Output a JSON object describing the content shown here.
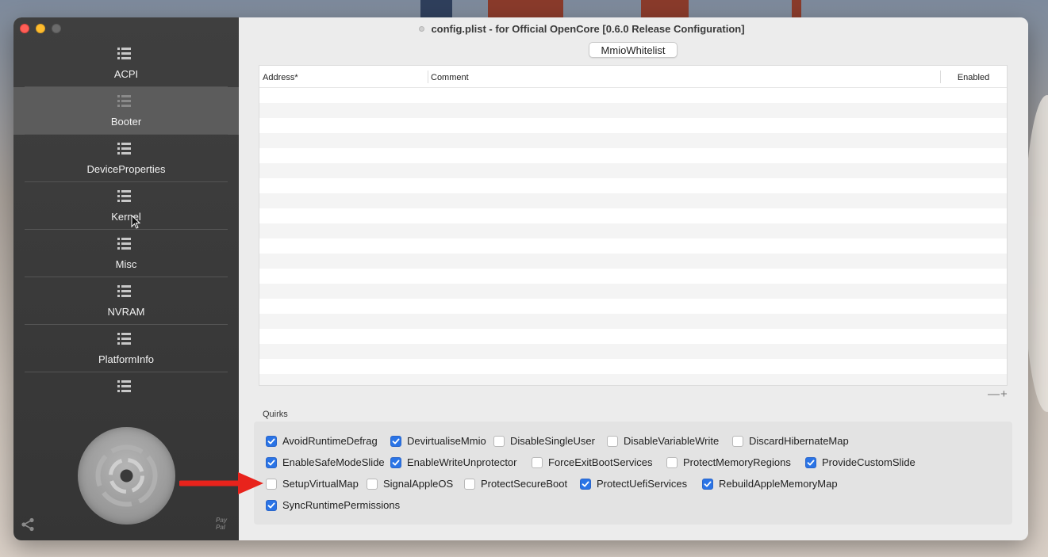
{
  "window": {
    "title": "config.plist - for Official OpenCore [0.6.0 Release Configuration]"
  },
  "sidebar": {
    "items": [
      {
        "label": "ACPI",
        "icon": "list-icon",
        "active": false
      },
      {
        "label": "Booter",
        "icon": "list-icon",
        "active": true
      },
      {
        "label": "DeviceProperties",
        "icon": "list-icon",
        "active": false
      },
      {
        "label": "Kernel",
        "icon": "list-icon",
        "active": false
      },
      {
        "label": "Misc",
        "icon": "list-icon",
        "active": false
      },
      {
        "label": "NVRAM",
        "icon": "list-icon",
        "active": false
      },
      {
        "label": "PlatformInfo",
        "icon": "list-icon",
        "active": false
      },
      {
        "label": "",
        "icon": "list-icon",
        "active": false
      }
    ],
    "paypal": "Pay\nPal"
  },
  "main": {
    "tab_label": "MmioWhitelist",
    "table": {
      "columns": [
        "Address*",
        "Comment",
        "Enabled"
      ],
      "rows": []
    },
    "add_remove": "—+",
    "quirks_label": "Quirks",
    "quirks": [
      {
        "label": "AvoidRuntimeDefrag",
        "checked": true
      },
      {
        "label": "DevirtualiseMmio",
        "checked": true
      },
      {
        "label": "DisableSingleUser",
        "checked": false
      },
      {
        "label": "DisableVariableWrite",
        "checked": false
      },
      {
        "label": "DiscardHibernateMap",
        "checked": false
      },
      {
        "label": "EnableSafeModeSlide",
        "checked": true
      },
      {
        "label": "EnableWriteUnprotector",
        "checked": true
      },
      {
        "label": "ForceExitBootServices",
        "checked": false
      },
      {
        "label": "ProtectMemoryRegions",
        "checked": false
      },
      {
        "label": "ProvideCustomSlide",
        "checked": true
      },
      {
        "label": "SetupVirtualMap",
        "checked": false
      },
      {
        "label": "SignalAppleOS",
        "checked": false
      },
      {
        "label": "ProtectSecureBoot",
        "checked": false
      },
      {
        "label": "ProtectUefiServices",
        "checked": true
      },
      {
        "label": "RebuildAppleMemoryMap",
        "checked": true
      },
      {
        "label": "SyncRuntimePermissions",
        "checked": true
      }
    ]
  },
  "colors": {
    "checkbox_on": "#2a74e6",
    "annotation_arrow": "#e8231c"
  }
}
